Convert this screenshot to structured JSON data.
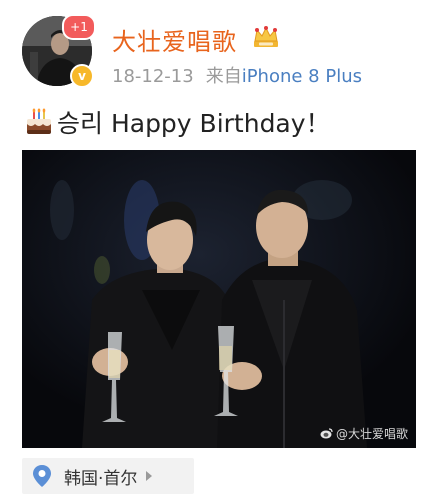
{
  "header": {
    "notification_badge": "+1",
    "verified_badge_glyph": "v",
    "username": "大壮爱唱歌",
    "crown_icon": "crown-icon",
    "date": "18-12-13",
    "source_prefix": "来自",
    "device": "iPhone 8 Plus"
  },
  "post": {
    "cake_icon": "birthday-cake-icon",
    "text": "승리 Happy Birthday！"
  },
  "photo": {
    "watermark": "@大壮爱唱歌"
  },
  "location": {
    "icon": "location-pin-icon",
    "label": "韩国·首尔"
  },
  "colors": {
    "username": "#e8641d",
    "device_link": "#4a7fc1",
    "meta_gray": "#9a9a9a",
    "badge_red": "#f25b5b",
    "verified_gold": "#f7b82a",
    "location_pin": "#5b8fd6"
  }
}
